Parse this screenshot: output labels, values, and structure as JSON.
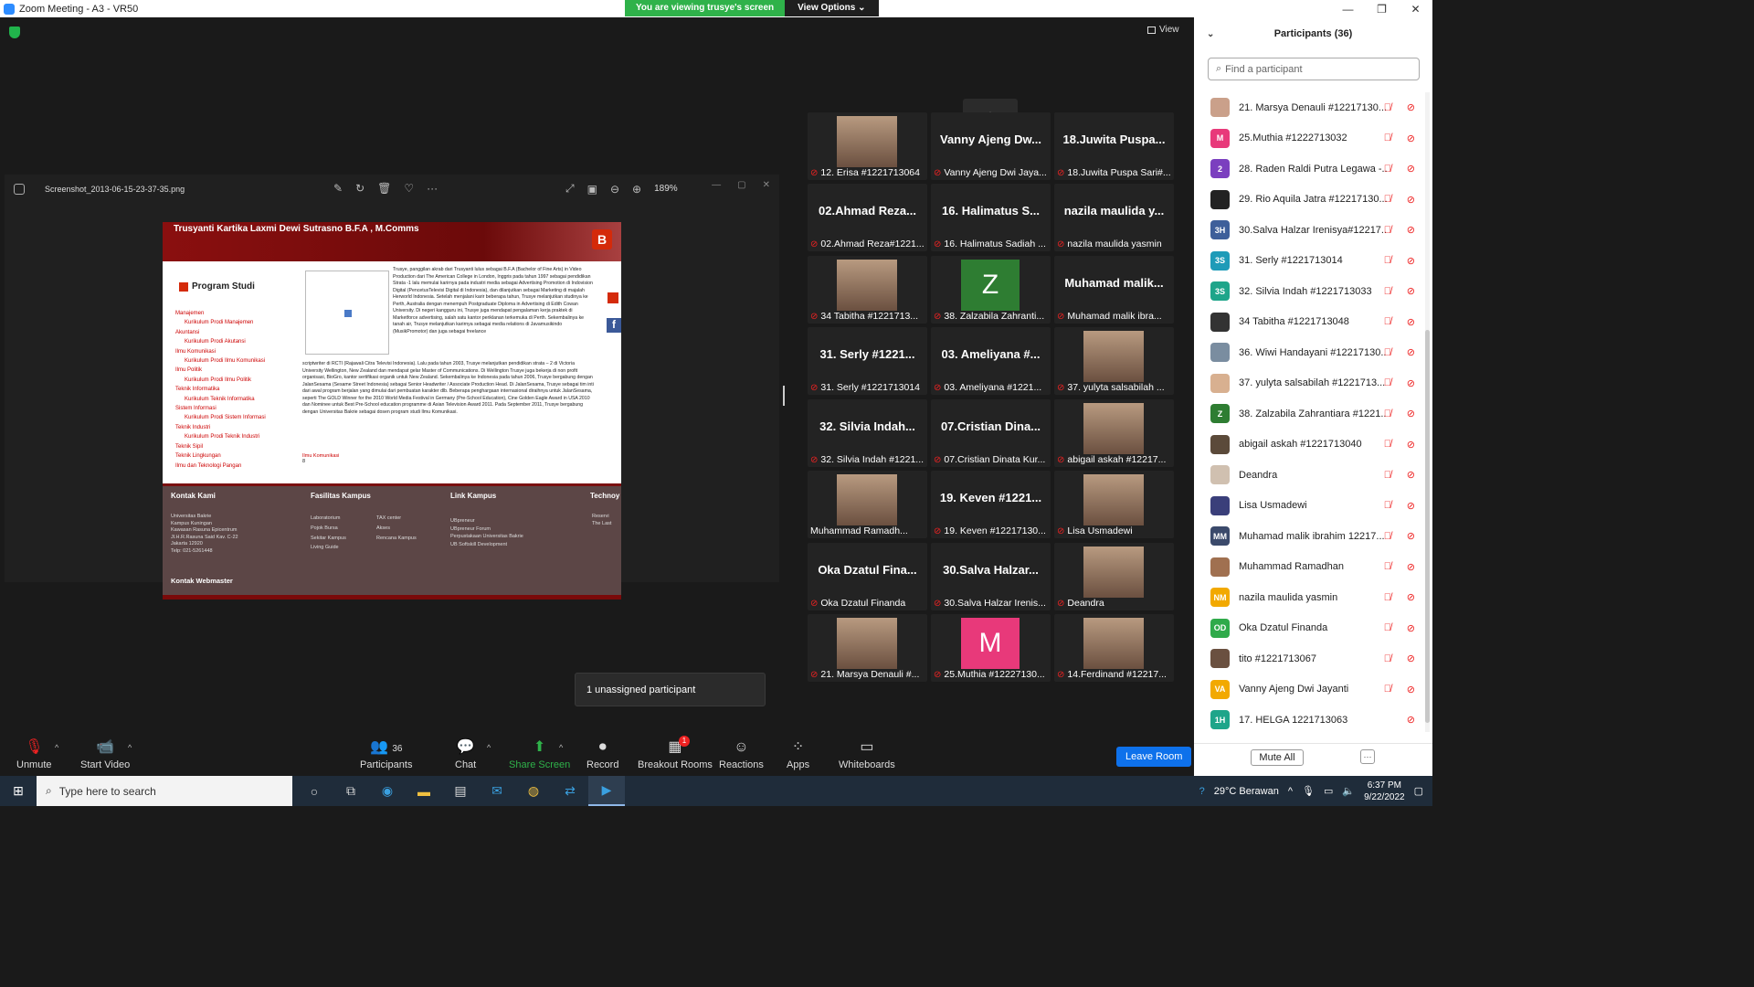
{
  "window": {
    "title": "Zoom Meeting - A3 - VR50"
  },
  "share_banner": {
    "status": "You are viewing trusye's screen",
    "options_label": "View Options"
  },
  "view_label": "View",
  "photo_viewer": {
    "filename": "Screenshot_2013-06-15-23-37-35.png",
    "zoom": "189%"
  },
  "webpage": {
    "header_name": "Trusyanti Kartika Laxmi Dewi Sutrasno B.F.A , M.Comms",
    "logo_letter": "B",
    "program_title": "Program Studi",
    "programs": [
      {
        "label": "Manajemen",
        "sub": false
      },
      {
        "label": "Kurikulum Prodi Manajemen",
        "sub": true
      },
      {
        "label": "Akuntansi",
        "sub": false
      },
      {
        "label": "Kurikulum Prodi Akutansi",
        "sub": true
      },
      {
        "label": "Ilmu Komunikasi",
        "sub": false
      },
      {
        "label": "Kurikulum Prodi Ilmu Komunikasi",
        "sub": true
      },
      {
        "label": "Ilmu Politik",
        "sub": false
      },
      {
        "label": "Kurikulum Prodi Ilmu Politik",
        "sub": true
      },
      {
        "label": "Teknik Informatika",
        "sub": false
      },
      {
        "label": "Kurikulum Teknik Informatika",
        "sub": true
      },
      {
        "label": "Sistem Informasi",
        "sub": false
      },
      {
        "label": "Kurikulum Prodi Sistem Informasi",
        "sub": true
      },
      {
        "label": "Teknik Industri",
        "sub": false
      },
      {
        "label": "Kurikulum Prodi Teknik Industri",
        "sub": true
      },
      {
        "label": "Teknik Sipil",
        "sub": false
      },
      {
        "label": "Teknik Lingkungan",
        "sub": false
      },
      {
        "label": "Ilmu dan Teknologi Pangan",
        "sub": false
      }
    ],
    "bio_1": "Trusye, panggilan akrab dari Trusyanti lulus sebagai B.F.A (Bachelor of Fine Arts) in Video Production dari The American College in London, Inggris pada tahun 1997 sebagai pendidikan Strata -1 lalu memulai karirnya pada industri media sebagai Advertising Promotion di Indovision Digital (PencetusTelevisi Digital di Indonesia), dan dilanjutkan sebagai Marketing di majalah Herworld Indonesia. Setelah menjalani karir beberapa tahun, Trusye melanjutkan studinya ke Perth, Australia dengan menempuh Postgraduate Diploma in Advertising di Edith Cowan University. Di negeri kangguru ini, Trusye juga mendapat pengalaman kerja praktek di Marketforce advertising, salah satu kantor periklanan terkemuka di Perth. Sekembalinya ke tanah air, Trusye melanjutkan karirnya sebagai media relations di Javamusikindo (MusikPromotor) dan juga sebagai freelance",
    "bio_2": "scriptwriter di RCTI (Rajawali Citra Televisi Indonesia). Lalu pada tahun 2003, Trusye melanjutkan pendidikan strata – 2 di Victoria University Wellington, New Zealand dan mendapat gelar Master of Communications. Di Wellington Trusye juga bekerja di non profit organisasi, BioGro, kantor sertifikasi organik untuk New Zealand. Sekembalinya ke Indonesia pada tahun 2006, Trusye bergabung dengan JalanSesama (Sesame Street Indonesia) sebagai Senior Headwriter / Associate Production Head. Di JalanSesama, Trusye sebagai tim inti dari awal program berjalan yang dimulai dari pembuatan karakter dlb. Beberapa penghargaan internasional diraihnya untuk JalanSesama, seperti The GOLD Winner for the 2010 World Media Festival in Germany (Pre-School Education), Cine Golden Eagle Award in USA 2010 dan Nominee untuk Best Pre-School education programme di Asian Television Award 2011. Pada September 2011, Trusye bergabung dengan Universitas Bakrie sebagai dosen program studi Ilmu Komunikasi.",
    "bio_link": "Ilmu Komunikasi",
    "bio_num": "8",
    "footer": {
      "kontak_title": "Kontak Kami",
      "kontak_lines": [
        "Universitas Bakrie",
        "Kampus Kuningan",
        "Kawasan Rasuna Epicentrum",
        "Jl.H.R.Rasuna Said Kav. C-22",
        "Jakarta 12920",
        "Telp: 021-5261448"
      ],
      "fasilitas_title": "Fasilitas Kampus",
      "fasilitas_a": [
        "Laboratorium",
        "Pojok Bursa",
        "Sekitar Kampus",
        "Living Guide"
      ],
      "fasilitas_b": [
        "TAX center",
        "Akses",
        "Rencana Kampus"
      ],
      "link_title": "Link Kampus",
      "links": [
        "UBpreneur",
        "UBpreneur Forum",
        "Perpustakaan Universitas Bakrie",
        "UB Softskill Development"
      ],
      "techno_title": "Technoy",
      "techno_lines": [
        "Reservi",
        "The Last"
      ],
      "webmaster_title": "Kontak Webmaster"
    }
  },
  "tiles": [
    {
      "big": "",
      "label": "12. Erisa #1221713064",
      "video": true
    },
    {
      "big": "Vanny Ajeng Dw...",
      "label": "Vanny Ajeng Dwi Jaya...",
      "video": false
    },
    {
      "big": "18.Juwita Puspa...",
      "label": "18.Juwita Puspa Sari#...",
      "video": false
    },
    {
      "big": "02.Ahmad Reza...",
      "label": "02.Ahmad Reza#1221...",
      "video": false
    },
    {
      "big": "16. Halimatus S...",
      "label": "16. Halimatus Sadiah ...",
      "video": false
    },
    {
      "big": "nazila maulida y...",
      "label": "nazila maulida yasmin",
      "video": false
    },
    {
      "big": "",
      "label": "34 Tabitha #1221713...",
      "video": true
    },
    {
      "big": "Z",
      "label": "38. Zalzabila Zahranti...",
      "avatar_color": "#2e7d32"
    },
    {
      "big": "Muhamad malik...",
      "label": "Muhamad malik ibra...",
      "video": false
    },
    {
      "big": "31. Serly #1221...",
      "label": "31. Serly #1221713014",
      "video": false
    },
    {
      "big": "03. Ameliyana #...",
      "label": "03. Ameliyana #1221...",
      "video": false
    },
    {
      "big": "",
      "label": "37. yulyta salsabilah ...",
      "video": true
    },
    {
      "big": "32. Silvia Indah...",
      "label": "32. Silvia Indah #1221...",
      "video": false
    },
    {
      "big": "07.Cristian Dina...",
      "label": "07.Cristian Dinata Kur...",
      "video": false
    },
    {
      "big": "",
      "label": "abigail askah #12217...",
      "video": true
    },
    {
      "big": "",
      "label": "Muhammad Ramadh...",
      "video": true,
      "muted_hidden": true
    },
    {
      "big": "19. Keven #1221...",
      "label": "19. Keven #12217130...",
      "video": false
    },
    {
      "big": "",
      "label": "Lisa Usmadewi",
      "video": true
    },
    {
      "big": "Oka Dzatul Fina...",
      "label": "Oka Dzatul Finanda",
      "video": false
    },
    {
      "big": "30.Salva Halzar...",
      "label": "30.Salva Halzar Irenis...",
      "video": false
    },
    {
      "big": "",
      "label": "Deandra",
      "video": true
    },
    {
      "big": "",
      "label": "21. Marsya Denauli #...",
      "video": true
    },
    {
      "big": "M",
      "label": "25.Muthia #12227130...",
      "avatar_color": "#e8397a"
    },
    {
      "big": "",
      "label": "14.Ferdinand #12217...",
      "video": true
    }
  ],
  "unassigned": "1 unassigned participant",
  "toolbar": {
    "unmute": "Unmute",
    "start_video": "Start Video",
    "participants": "Participants",
    "participants_count": "36",
    "chat": "Chat",
    "share": "Share Screen",
    "record": "Record",
    "breakout": "Breakout Rooms",
    "breakout_badge": "1",
    "reactions": "Reactions",
    "apps": "Apps",
    "whiteboards": "Whiteboards",
    "leave": "Leave Room"
  },
  "panel": {
    "title": "Participants (36)",
    "search_placeholder": "Find a participant",
    "participants": [
      {
        "initials": "",
        "name": "21. Marsya Denauli #12217130...",
        "color": "#caa08a",
        "photo": true
      },
      {
        "initials": "M",
        "name": "25.Muthia #1222713032",
        "color": "#e8397a"
      },
      {
        "initials": "2",
        "name": "28. Raden Raldi Putra Legawa -...",
        "color": "#7b3fbf"
      },
      {
        "initials": "",
        "name": "29. Rio Aquila Jatra #12217130...",
        "color": "#222222",
        "photo": true
      },
      {
        "initials": "3H",
        "name": "30.Salva Halzar Irenisya#12217...",
        "color": "#3e5f9a"
      },
      {
        "initials": "3S",
        "name": "31. Serly #1221713014",
        "color": "#1e9bb8"
      },
      {
        "initials": "3S",
        "name": "32. Silvia Indah #1221713033",
        "color": "#1ea58a"
      },
      {
        "initials": "",
        "name": "34 Tabitha #1221713048",
        "color": "#333333",
        "photo": true
      },
      {
        "initials": "",
        "name": "36. Wiwi Handayani #12217130...",
        "color": "#7a8da0",
        "photo": true
      },
      {
        "initials": "",
        "name": "37. yulyta salsabilah #1221713...",
        "color": "#d8b090",
        "photo": true
      },
      {
        "initials": "Z",
        "name": "38. Zalzabila Zahrantiara #1221...",
        "color": "#2e7d32"
      },
      {
        "initials": "",
        "name": "abigail askah #1221713040",
        "color": "#5b4a3a",
        "photo": true
      },
      {
        "initials": "",
        "name": "Deandra",
        "color": "#d0c0b0",
        "photo": true
      },
      {
        "initials": "",
        "name": "Lisa Usmadewi",
        "color": "#3a3f7a",
        "photo": true
      },
      {
        "initials": "MM",
        "name": "Muhamad malik ibrahim 12217...",
        "color": "#3b4a6b"
      },
      {
        "initials": "",
        "name": "Muhammad Ramadhan",
        "color": "#a07050",
        "photo": true
      },
      {
        "initials": "NM",
        "name": "nazila maulida yasmin",
        "color": "#f2a900"
      },
      {
        "initials": "OD",
        "name": "Oka Dzatul Finanda",
        "color": "#2faa4a"
      },
      {
        "initials": "",
        "name": "tito #1221713067",
        "color": "#6a5040",
        "photo": true
      },
      {
        "initials": "VA",
        "name": "Vanny Ajeng Dwi Jayanti",
        "color": "#f2a900"
      },
      {
        "initials": "1H",
        "name": "17. HELGA 1221713063",
        "color": "#1ea58a",
        "no_mic": true
      }
    ],
    "mute_all": "Mute All",
    "more": "···"
  },
  "taskbar": {
    "search_placeholder": "Type here to search",
    "weather": "29°C  Berawan",
    "time": "6:37 PM",
    "date": "9/22/2022"
  }
}
